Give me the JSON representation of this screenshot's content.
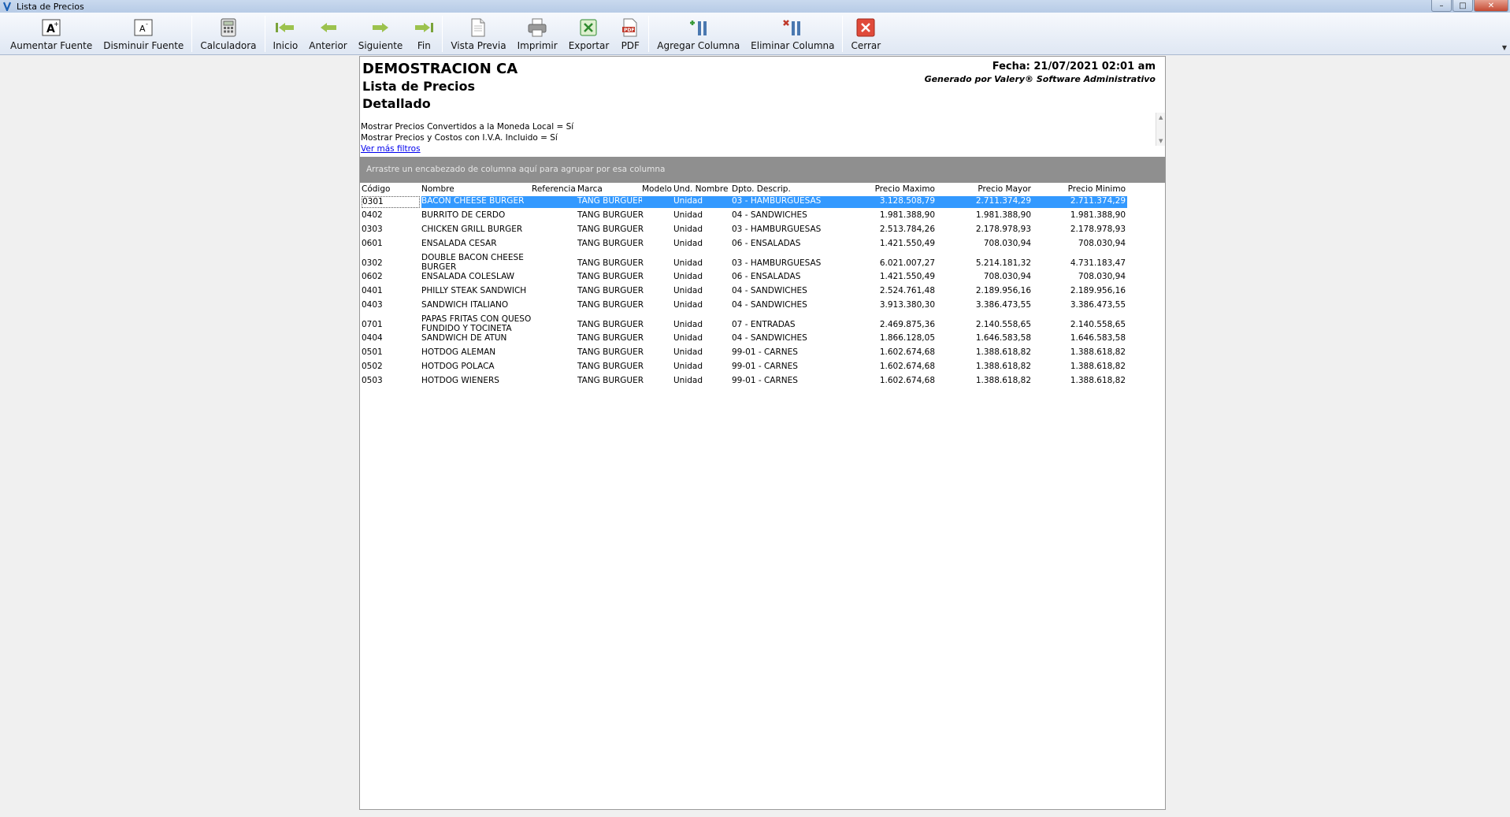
{
  "window": {
    "title": "Lista de Precios",
    "minimize": "–",
    "maximize": "□",
    "close": "✕"
  },
  "toolbar": {
    "buttons": [
      {
        "id": "aumentar",
        "label": "Aumentar Fuente",
        "icon": "font-increase-icon"
      },
      {
        "id": "disminuir",
        "label": "Disminuir Fuente",
        "icon": "font-decrease-icon"
      },
      {
        "id": "calc",
        "label": "Calculadora",
        "icon": "calculator-icon"
      },
      {
        "id": "inicio",
        "label": "Inicio",
        "icon": "first-arrow-icon"
      },
      {
        "id": "anterior",
        "label": "Anterior",
        "icon": "prev-arrow-icon"
      },
      {
        "id": "siguiente",
        "label": "Siguiente",
        "icon": "next-arrow-icon"
      },
      {
        "id": "fin",
        "label": "Fin",
        "icon": "last-arrow-icon"
      },
      {
        "id": "vista",
        "label": "Vista Previa",
        "icon": "preview-icon"
      },
      {
        "id": "imprimir",
        "label": "Imprimir",
        "icon": "printer-icon"
      },
      {
        "id": "exportar",
        "label": "Exportar",
        "icon": "excel-icon"
      },
      {
        "id": "pdf",
        "label": "PDF",
        "icon": "pdf-icon"
      },
      {
        "id": "agregar",
        "label": "Agregar Columna",
        "icon": "add-column-icon"
      },
      {
        "id": "eliminar",
        "label": "Eliminar Columna",
        "icon": "remove-column-icon"
      },
      {
        "id": "cerrar",
        "label": "Cerrar",
        "icon": "close-red-icon"
      }
    ]
  },
  "report": {
    "company": "DEMOSTRACION CA",
    "title": "Lista de Precios",
    "subtitle": "Detallado",
    "fecha": "Fecha: 21/07/2021 02:01 am",
    "generated": "Generado por Valery® Software Administrativo",
    "filters": [
      "Mostrar Precios Convertidos a la Moneda Local = Sí",
      "Mostrar Precios y Costos con I.V.A. Incluido = Sí"
    ],
    "more_filters": "Ver más filtros",
    "group_hint": "Arrastre un encabezado de columna aquí para agrupar por esa columna"
  },
  "grid": {
    "columns": [
      "Código",
      "Nombre",
      "Referencia",
      "Marca",
      "Modelo",
      "Und. Nombre",
      "Dpto. Descrip.",
      "Precio Maximo",
      "Precio Mayor",
      "Precio Minimo"
    ],
    "rows": [
      {
        "codigo": "0301",
        "nombre": "BACON CHEESE BURGER",
        "referencia": "",
        "marca": "TANG BURGUER",
        "modelo": "",
        "und": "Unidad",
        "dpto": "03 - HAMBURGUESAS",
        "pmax": "3.128.508,79",
        "pmay": "2.711.374,29",
        "pmin": "2.711.374,29",
        "selected": true
      },
      {
        "codigo": "0402",
        "nombre": "BURRITO DE CERDO",
        "referencia": "",
        "marca": "TANG BURGUER",
        "modelo": "",
        "und": "Unidad",
        "dpto": "04 - SANDWICHES",
        "pmax": "1.981.388,90",
        "pmay": "1.981.388,90",
        "pmin": "1.981.388,90"
      },
      {
        "codigo": "0303",
        "nombre": "CHICKEN GRILL BURGER",
        "referencia": "",
        "marca": "TANG BURGUER",
        "modelo": "",
        "und": "Unidad",
        "dpto": "03 - HAMBURGUESAS",
        "pmax": "2.513.784,26",
        "pmay": "2.178.978,93",
        "pmin": "2.178.978,93"
      },
      {
        "codigo": "0601",
        "nombre": "ENSALADA CESAR",
        "referencia": "",
        "marca": "TANG BURGUER",
        "modelo": "",
        "und": "Unidad",
        "dpto": "06 - ENSALADAS",
        "pmax": "1.421.550,49",
        "pmay": "708.030,94",
        "pmin": "708.030,94"
      },
      {
        "codigo": "0302",
        "nombre": "DOUBLE BACON CHEESE BURGER",
        "referencia": "",
        "marca": "TANG BURGUER",
        "modelo": "",
        "und": "Unidad",
        "dpto": "03 - HAMBURGUESAS",
        "pmax": "6.021.007,27",
        "pmay": "5.214.181,32",
        "pmin": "4.731.183,47",
        "tall": true
      },
      {
        "codigo": "0602",
        "nombre": "ENSALADA COLESLAW",
        "referencia": "",
        "marca": "TANG BURGUER",
        "modelo": "",
        "und": "Unidad",
        "dpto": "06 - ENSALADAS",
        "pmax": "1.421.550,49",
        "pmay": "708.030,94",
        "pmin": "708.030,94"
      },
      {
        "codigo": "0401",
        "nombre": "PHILLY STEAK SANDWICH",
        "referencia": "",
        "marca": "TANG BURGUER",
        "modelo": "",
        "und": "Unidad",
        "dpto": "04 - SANDWICHES",
        "pmax": "2.524.761,48",
        "pmay": "2.189.956,16",
        "pmin": "2.189.956,16"
      },
      {
        "codigo": "0403",
        "nombre": "SANDWICH ITALIANO",
        "referencia": "",
        "marca": "TANG BURGUER",
        "modelo": "",
        "und": "Unidad",
        "dpto": "04 - SANDWICHES",
        "pmax": "3.913.380,30",
        "pmay": "3.386.473,55",
        "pmin": "3.386.473,55"
      },
      {
        "codigo": "0701",
        "nombre": "PAPAS FRITAS CON QUESO FUNDIDO Y TOCINETA",
        "referencia": "",
        "marca": "TANG BURGUER",
        "modelo": "",
        "und": "Unidad",
        "dpto": "07 - ENTRADAS",
        "pmax": "2.469.875,36",
        "pmay": "2.140.558,65",
        "pmin": "2.140.558,65",
        "tall": true
      },
      {
        "codigo": "0404",
        "nombre": "SANDWICH DE ATUN",
        "referencia": "",
        "marca": "TANG BURGUER",
        "modelo": "",
        "und": "Unidad",
        "dpto": "04 - SANDWICHES",
        "pmax": "1.866.128,05",
        "pmay": "1.646.583,58",
        "pmin": "1.646.583,58"
      },
      {
        "codigo": "0501",
        "nombre": "HOTDOG ALEMAN",
        "referencia": "",
        "marca": "TANG BURGUER",
        "modelo": "",
        "und": "Unidad",
        "dpto": "99-01 - CARNES",
        "pmax": "1.602.674,68",
        "pmay": "1.388.618,82",
        "pmin": "1.388.618,82"
      },
      {
        "codigo": "0502",
        "nombre": "HOTDOG POLACA",
        "referencia": "",
        "marca": "TANG BURGUER",
        "modelo": "",
        "und": "Unidad",
        "dpto": "99-01 - CARNES",
        "pmax": "1.602.674,68",
        "pmay": "1.388.618,82",
        "pmin": "1.388.618,82"
      },
      {
        "codigo": "0503",
        "nombre": "HOTDOG WIENERS",
        "referencia": "",
        "marca": "TANG BURGUER",
        "modelo": "",
        "und": "Unidad",
        "dpto": "99-01 - CARNES",
        "pmax": "1.602.674,68",
        "pmay": "1.388.618,82",
        "pmin": "1.388.618,82"
      }
    ]
  },
  "colors": {
    "selection": "#3399ff",
    "group_bar": "#8f8f8f",
    "link": "#0000ee"
  }
}
